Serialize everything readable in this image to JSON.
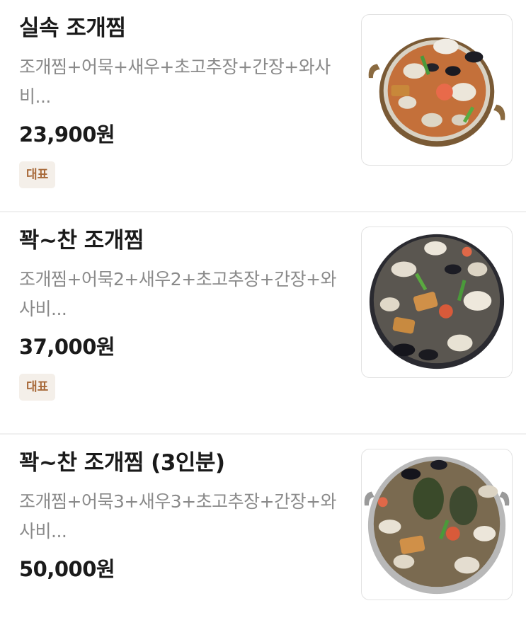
{
  "menu": {
    "items": [
      {
        "name": "실속 조개찜",
        "description": "조개찜+어묵+새우+초고추장+간장+와사비...",
        "price": "23,900원",
        "badge": "대표",
        "image": "clam-stew-pot-image"
      },
      {
        "name": "꽉~찬 조개찜",
        "description": "조개찜+어묵2+새우2+초고추장+간장+와사비...",
        "price": "37,000원",
        "badge": "대표",
        "image": "clam-stew-pan-image"
      },
      {
        "name": "꽉~찬 조개찜 (3인분)",
        "description": "조개찜+어묵3+새우3+초고추장+간장+와사비...",
        "price": "50,000원",
        "image": "clam-stew-large-pot-image"
      }
    ]
  },
  "colors": {
    "badge_bg": "#f4efe9",
    "badge_text": "#a86a3a",
    "divider": "#f0f0f0"
  }
}
